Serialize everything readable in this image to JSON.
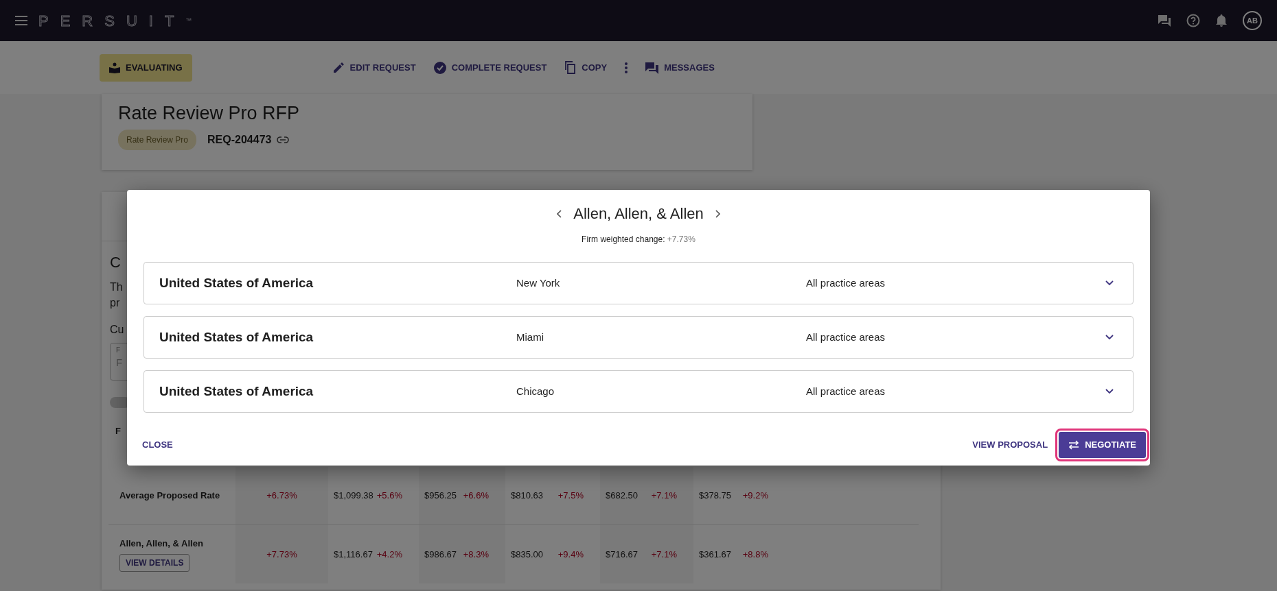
{
  "top_bar": {
    "logo": "PERSUIT",
    "logo_mark": "™",
    "avatar": "AB"
  },
  "action_bar": {
    "status": "EVALUATING",
    "actions": [
      {
        "kind": "edit",
        "label": "EDIT REQUEST"
      },
      {
        "kind": "complete",
        "label": "COMPLETE REQUEST"
      },
      {
        "kind": "copy",
        "label": "COPY"
      },
      {
        "kind": "more"
      },
      {
        "kind": "messages",
        "label": "MESSAGES"
      }
    ]
  },
  "request": {
    "title": "Rate Review Pro RFP",
    "tag": "Rate Review Pro",
    "id": "REQ-204473"
  },
  "section": {
    "heading": "C",
    "text_lines": [
      "Th",
      "pr"
    ],
    "field_caption": "Cu",
    "field_label": "F",
    "field_value": "F",
    "toggle_on": false,
    "table_header": "F"
  },
  "table": {
    "rows": [
      {
        "name": "Average Proposed Rate",
        "change": "+6.73%",
        "pairs": [
          [
            "$1,099.38",
            "+5.6%"
          ],
          [
            "$956.25",
            "+6.6%"
          ],
          [
            "$810.63",
            "+7.5%"
          ],
          [
            "$682.50",
            "+7.1%"
          ],
          [
            "$378.75",
            "+9.2%"
          ]
        ]
      },
      {
        "name": "Allen, Allen, & Allen",
        "button": "VIEW DETAILS",
        "change": "+7.73%",
        "pairs": [
          [
            "$1,116.67",
            "+4.2%"
          ],
          [
            "$986.67",
            "+8.3%"
          ],
          [
            "$835.00",
            "+9.4%"
          ],
          [
            "$716.67",
            "+7.1%"
          ],
          [
            "$361.67",
            "+8.8%"
          ]
        ]
      }
    ]
  },
  "dialog": {
    "title": "Allen, Allen, & Allen",
    "weighted_label": "Firm weighted change:",
    "weighted_value": "+7.73%",
    "locations": [
      {
        "country": "United States of America",
        "city": "New York",
        "practice": "All practice areas",
        "expanded": false
      },
      {
        "country": "United States of America",
        "city": "Miami",
        "practice": "All practice areas",
        "expanded": false
      },
      {
        "country": "United States of America",
        "city": "Chicago",
        "practice": "All practice areas",
        "expanded": false
      }
    ],
    "close": "CLOSE",
    "view": "VIEW PROPOSAL",
    "negotiate": {
      "label": "NEGOTIATE",
      "focused": true
    }
  }
}
